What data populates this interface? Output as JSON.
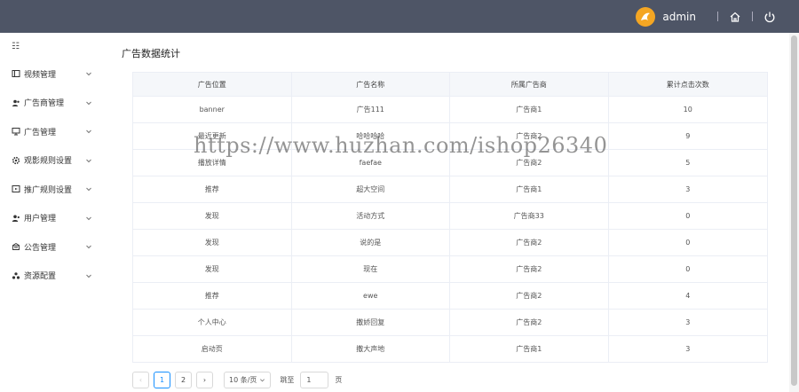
{
  "header": {
    "username": "admin"
  },
  "sidebar": {
    "toggle_glyph": "☷",
    "items": [
      {
        "label": "视频管理",
        "icon": "video-icon"
      },
      {
        "label": "广告商管理",
        "icon": "advertiser-icon"
      },
      {
        "label": "广告管理",
        "icon": "ad-icon"
      },
      {
        "label": "观影规则设置",
        "icon": "gear-icon"
      },
      {
        "label": "推广规则设置",
        "icon": "promo-icon"
      },
      {
        "label": "用户管理",
        "icon": "user-icon"
      },
      {
        "label": "公告管理",
        "icon": "notice-icon"
      },
      {
        "label": "资源配置",
        "icon": "resource-icon"
      }
    ]
  },
  "main": {
    "title": "广告数据统计",
    "table": {
      "headers": [
        "广告位置",
        "广告名称",
        "所属广告商",
        "累计点击次数"
      ],
      "rows": [
        [
          "banner",
          "广告111",
          "广告商1",
          "10"
        ],
        [
          "最近更新",
          "哈哈哈哈",
          "广告商2",
          "9"
        ],
        [
          "播放详情",
          "faefae",
          "广告商2",
          "5"
        ],
        [
          "推荐",
          "超大空间",
          "广告商1",
          "3"
        ],
        [
          "发现",
          "活动方式",
          "广告商33",
          "0"
        ],
        [
          "发现",
          "说的是",
          "广告商2",
          "0"
        ],
        [
          "发现",
          "现在",
          "广告商2",
          "0"
        ],
        [
          "推荐",
          "ewe",
          "广告商2",
          "4"
        ],
        [
          "个人中心",
          "撒娇回复",
          "广告商2",
          "3"
        ],
        [
          "启动页",
          "撒大声地",
          "广告商1",
          "3"
        ]
      ]
    },
    "pagination": {
      "prev": "‹",
      "next": "›",
      "pages": [
        "1",
        "2"
      ],
      "current": "1",
      "page_size": "10 条/页",
      "jump_label": "跳至",
      "jump_value": "1",
      "page_unit": "页"
    }
  },
  "watermark": "https://www.huzhan.com/ishop26340",
  "colors": {
    "topbar": "#4e5566",
    "accent": "#1890ff",
    "avatar": "#f4a623"
  }
}
